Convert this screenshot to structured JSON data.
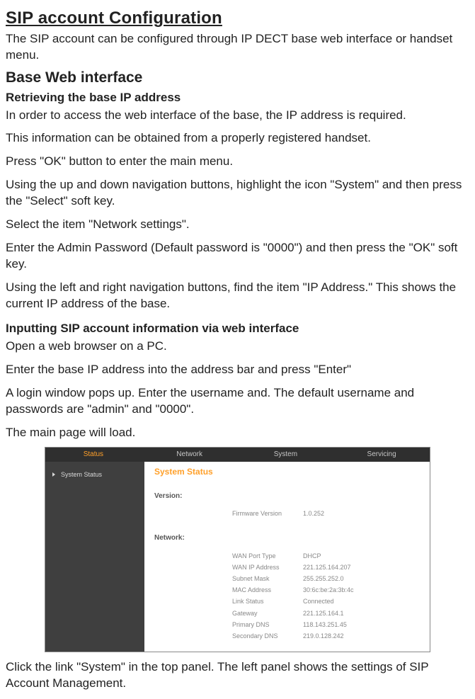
{
  "title": "SIP account Configuration",
  "intro": "The SIP account can be configured through IP DECT base web interface or handset menu.",
  "h2_base_web": "Base Web interface",
  "h3_retrieve": "Retrieving the base IP address",
  "p1": "In order to access the web interface of the base, the IP address is required.",
  "p2": "This information can be obtained from a properly registered handset.",
  "p3": "Press \"OK\" button to enter the main menu.",
  "p4": "Using the up and down navigation buttons, highlight the icon \"System\" and then press the \"Select\" soft key.",
  "p5": "Select the item \"Network settings\".",
  "p6": "Enter the Admin Password (Default password is \"0000\") and then press the \"OK\" soft key.",
  "p7": "Using the left and right navigation buttons, find the item \"IP Address.\"   This shows the current IP address of the base.",
  "h3_input": "Inputting SIP account information via web interface",
  "p8": "Open a web browser on a PC.",
  "p9": "Enter the base IP address into the address bar and press \"Enter\"",
  "p10": "A login window pops up. Enter the username and.  The default username and passwords are \"admin\" and \"0000\".",
  "p11": "The main page will load.",
  "p12": "Click the link \"System\" in the top panel. The left panel shows the settings of SIP Account Management.",
  "screenshot": {
    "tabs": {
      "status": "Status",
      "network": "Network",
      "system": "System",
      "servicing": "Servicing"
    },
    "sidebar": {
      "item1": "System Status"
    },
    "mainTitle": "System Status",
    "version": {
      "label": "Version:",
      "rows": {
        "fw_k": "Firmware Version",
        "fw_v": "1.0.252"
      }
    },
    "network": {
      "label": "Network:",
      "rows": {
        "wpt_k": "WAN Port Type",
        "wpt_v": "DHCP",
        "wip_k": "WAN IP Address",
        "wip_v": "221.125.164.207",
        "sm_k": "Subnet Mask",
        "sm_v": "255.255.252.0",
        "mac_k": "MAC Address",
        "mac_v": "30:6c:be:2a:3b:4c",
        "ls_k": "Link Status",
        "ls_v": "Connected",
        "gw_k": "Gateway",
        "gw_v": "221.125.164.1",
        "pd_k": "Primary DNS",
        "pd_v": "118.143.251.45",
        "sd_k": "Secondary DNS",
        "sd_v": "219.0.128.242"
      }
    }
  }
}
